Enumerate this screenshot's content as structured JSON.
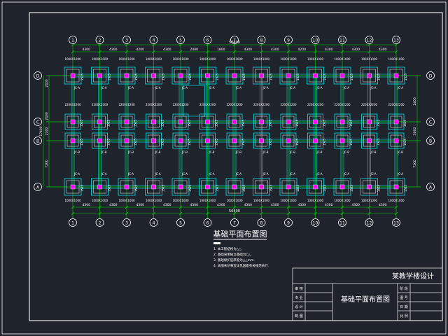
{
  "drawing": {
    "title": "基础平面布置图",
    "notes": [
      "1. 本工程结构为△△.",
      "2. 基础采用独立基础为C△.",
      "3. 基础保护层厚度为△△mm.",
      "4. 本图未尽事宜详见国家有关规范执行."
    ],
    "column_axes": [
      "1",
      "2",
      "3",
      "4",
      "5",
      "6",
      "7",
      "8",
      "9",
      "10",
      "11",
      "12",
      "13"
    ],
    "row_axes": [
      "D",
      "C",
      "B",
      "A"
    ],
    "dims_top": [
      "4300",
      "4300",
      "4200",
      "4300",
      "2400",
      "1800",
      "4300",
      "4300",
      "4200",
      "4300",
      "4300",
      "4300"
    ],
    "dims_bottom": [
      "4300",
      "4300",
      "4300",
      "4300",
      "4300",
      "4300",
      "4300",
      "4300",
      "4300",
      "4300",
      "4300",
      "4300"
    ],
    "overall_dim": "50400",
    "dims_left": [
      "2400",
      "2400",
      "2100",
      "7200"
    ],
    "dims_left_total": "17400",
    "dims_right": [
      "2400",
      "3000",
      "7200"
    ],
    "footing_size": "1000X1000",
    "footing_size_wide": "2200X2200",
    "footing_tag_a": "JC-A",
    "footing_tag_b": "JC-B",
    "rebar_note": "1525",
    "colors": {
      "background": "#1f232c",
      "axis": "#00d000",
      "footing": "#00ffff",
      "column": "#ff00ff",
      "text": "#ffffff"
    }
  },
  "titleblock": {
    "project": "某教学楼设计",
    "drawing_name": "基础平面布置图",
    "left_labels": [
      "审 核",
      "专 业",
      "设 计",
      "制 图"
    ],
    "right_labels": [
      "阶 段",
      "图 号",
      "日 期",
      "比 例"
    ]
  }
}
